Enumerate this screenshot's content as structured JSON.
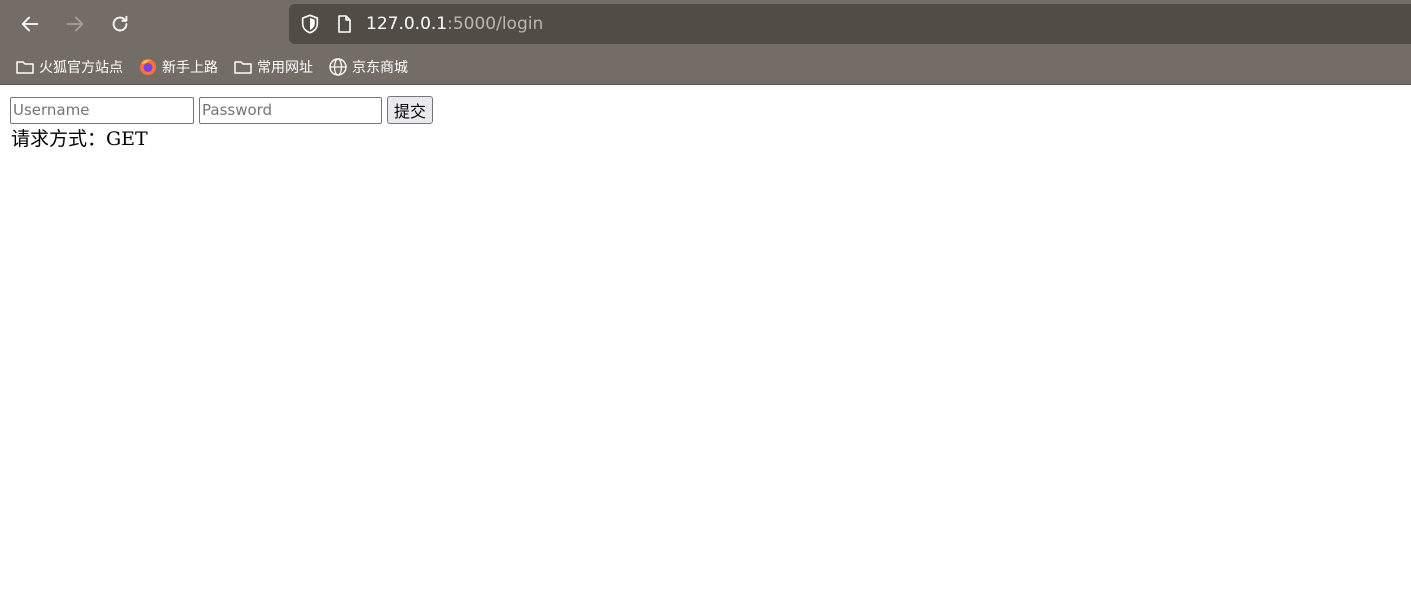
{
  "browser": {
    "url_host": "127.0.0.1",
    "url_rest": ":5000/login",
    "bookmarks": [
      {
        "label": "火狐官方站点",
        "icon": "folder-icon"
      },
      {
        "label": "新手上路",
        "icon": "firefox-icon"
      },
      {
        "label": "常用网址",
        "icon": "folder-icon"
      },
      {
        "label": "京东商城",
        "icon": "globe-icon"
      }
    ]
  },
  "form": {
    "username_placeholder": "Username",
    "password_placeholder": "Password",
    "submit_label": "提交"
  },
  "page": {
    "request_method_text": "请求方式：GET"
  },
  "colors": {
    "chrome_bg": "#736d66",
    "urlbar_bg": "#524c46"
  }
}
